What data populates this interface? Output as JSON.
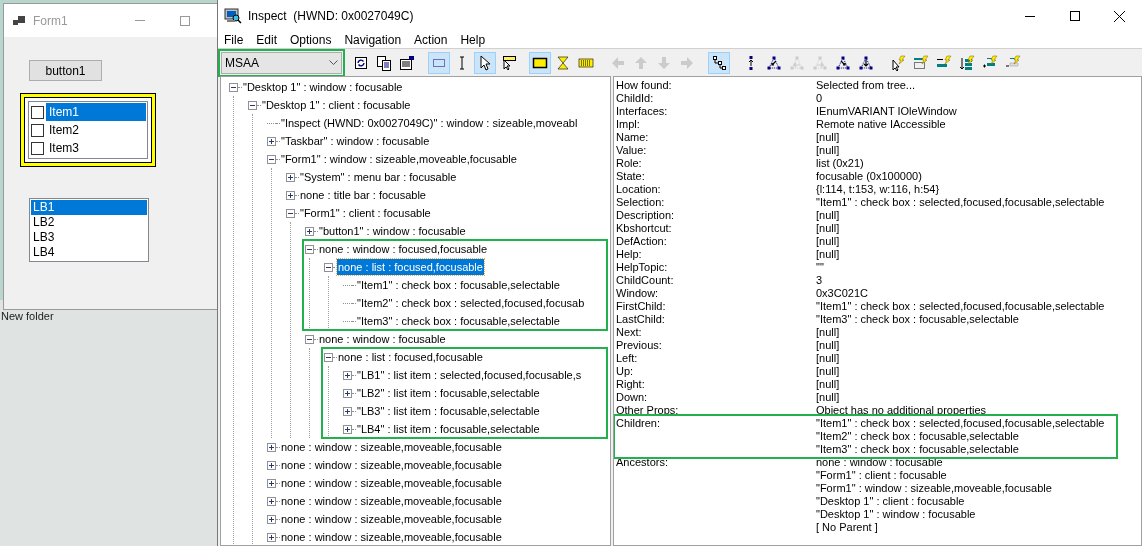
{
  "desktop": {
    "folder_label": "New folder"
  },
  "form1": {
    "title": "Form1",
    "button": "button1",
    "checklist": {
      "highlighted": true,
      "items": [
        {
          "label": "Item1",
          "checked": false,
          "selected": true
        },
        {
          "label": "Item2",
          "checked": false,
          "selected": false
        },
        {
          "label": "Item3",
          "checked": false,
          "selected": false
        }
      ]
    },
    "listbox": {
      "items": [
        {
          "label": "LB1",
          "selected": true
        },
        {
          "label": "LB2",
          "selected": false
        },
        {
          "label": "LB3",
          "selected": false
        },
        {
          "label": "LB4",
          "selected": false
        }
      ]
    }
  },
  "inspect": {
    "title": "Inspect  (HWND: 0x0027049C)",
    "menu": [
      "File",
      "Edit",
      "Options",
      "Navigation",
      "Action",
      "Help"
    ],
    "mode": {
      "value": "MSAA",
      "highlighted": true
    },
    "toolbar_groups": [
      [
        {
          "kind": "refresh",
          "pressed": false,
          "disabled": false
        },
        {
          "kind": "copy",
          "pressed": false,
          "disabled": false
        },
        {
          "kind": "properties",
          "pressed": false,
          "disabled": false
        }
      ],
      [
        {
          "kind": "rect-select",
          "pressed": true,
          "disabled": false
        },
        {
          "kind": "text-cursor",
          "pressed": false,
          "disabled": false
        },
        {
          "kind": "pointer",
          "pressed": true,
          "disabled": false
        },
        {
          "kind": "pointer-tip",
          "pressed": false,
          "disabled": false
        }
      ],
      [
        {
          "kind": "highlight-rect",
          "pressed": true,
          "disabled": false
        },
        {
          "kind": "hourglass",
          "pressed": false,
          "disabled": false
        },
        {
          "kind": "keyboard",
          "pressed": false,
          "disabled": false
        }
      ],
      [
        {
          "kind": "nav-left",
          "pressed": false,
          "disabled": true
        },
        {
          "kind": "nav-up",
          "pressed": false,
          "disabled": true
        },
        {
          "kind": "nav-down",
          "pressed": false,
          "disabled": true
        },
        {
          "kind": "nav-right",
          "pressed": false,
          "disabled": true
        }
      ],
      [
        {
          "kind": "tree-view",
          "pressed": true,
          "disabled": false
        }
      ],
      [
        {
          "kind": "nav-parent",
          "pressed": false,
          "disabled": false
        },
        {
          "kind": "tri-first",
          "pressed": false,
          "disabled": false
        },
        {
          "kind": "tri-prev",
          "pressed": false,
          "disabled": true
        },
        {
          "kind": "tri-next",
          "pressed": false,
          "disabled": true
        },
        {
          "kind": "tri-last",
          "pressed": false,
          "disabled": false
        },
        {
          "kind": "tri-children",
          "pressed": false,
          "disabled": false
        }
      ],
      [
        {
          "kind": "flash-pointer",
          "pressed": false,
          "disabled": false
        },
        {
          "kind": "flash-rect",
          "pressed": false,
          "disabled": false
        },
        {
          "kind": "flash-bar",
          "pressed": false,
          "disabled": false
        },
        {
          "kind": "flash-down",
          "pressed": false,
          "disabled": false
        },
        {
          "kind": "flash-add",
          "pressed": false,
          "disabled": false
        },
        {
          "kind": "flash-remove",
          "pressed": false,
          "disabled": false
        }
      ]
    ],
    "tree": [
      {
        "text": "\"Desktop 1\" : window : focusable",
        "kind": "expanded",
        "selected": false,
        "highlighted": false,
        "children": [
          {
            "text": "\"Desktop 1\" : client : focusable",
            "kind": "expanded",
            "selected": false,
            "highlighted": false,
            "children": [
              {
                "text": "\"Inspect  (HWND: 0x0027049C)\" : window : sizeable,moveabl",
                "kind": "leaf",
                "selected": false,
                "highlighted": false
              },
              {
                "text": "\"Taskbar\" : window : focusable",
                "kind": "collapsed",
                "selected": false,
                "highlighted": false
              },
              {
                "text": "\"Form1\" : window : sizeable,moveable,focusable",
                "kind": "expanded",
                "selected": false,
                "highlighted": false,
                "children": [
                  {
                    "text": "\"System\" : menu bar : focusable",
                    "kind": "collapsed",
                    "selected": false,
                    "highlighted": false
                  },
                  {
                    "text": "none : title bar : focusable",
                    "kind": "collapsed",
                    "selected": false,
                    "highlighted": false
                  },
                  {
                    "text": "\"Form1\" : client : focusable",
                    "kind": "expanded",
                    "selected": false,
                    "highlighted": false,
                    "children": [
                      {
                        "text": "\"button1\" : window : focusable",
                        "kind": "collapsed",
                        "selected": false,
                        "highlighted": false
                      },
                      {
                        "text": "none : window : focused,focusable",
                        "kind": "expanded",
                        "selected": false,
                        "highlighted": true,
                        "children": [
                          {
                            "text": "none : list : focused,focusable",
                            "kind": "expanded",
                            "selected": true,
                            "highlighted": false,
                            "children": [
                              {
                                "text": "\"Item1\" : check box : focusable,selectable",
                                "kind": "leaf",
                                "selected": false,
                                "highlighted": false
                              },
                              {
                                "text": "\"Item2\" : check box : selected,focused,focusab",
                                "kind": "leaf",
                                "selected": false,
                                "highlighted": false
                              },
                              {
                                "text": "\"Item3\" : check box : focusable,selectable",
                                "kind": "leaf",
                                "selected": false,
                                "highlighted": false
                              }
                            ]
                          }
                        ]
                      },
                      {
                        "text": "none : window : focusable",
                        "kind": "expanded",
                        "selected": false,
                        "highlighted": false,
                        "children": [
                          {
                            "text": "none : list : focused,focusable",
                            "kind": "expanded",
                            "selected": false,
                            "highlighted": true,
                            "children": [
                              {
                                "text": "\"LB1\" : list item : selected,focused,focusable,s",
                                "kind": "collapsed",
                                "selected": false,
                                "highlighted": false
                              },
                              {
                                "text": "\"LB2\" : list item : focusable,selectable",
                                "kind": "collapsed",
                                "selected": false,
                                "highlighted": false
                              },
                              {
                                "text": "\"LB3\" : list item : focusable,selectable",
                                "kind": "collapsed",
                                "selected": false,
                                "highlighted": false
                              },
                              {
                                "text": "\"LB4\" : list item : focusable,selectable",
                                "kind": "collapsed",
                                "selected": false,
                                "highlighted": false
                              }
                            ]
                          }
                        ]
                      }
                    ]
                  }
                ]
              },
              {
                "text": "none : window : sizeable,moveable,focusable",
                "kind": "collapsed",
                "selected": false,
                "highlighted": false
              },
              {
                "text": "none : window : sizeable,moveable,focusable",
                "kind": "collapsed",
                "selected": false,
                "highlighted": false
              },
              {
                "text": "none : window : sizeable,moveable,focusable",
                "kind": "collapsed",
                "selected": false,
                "highlighted": false
              },
              {
                "text": "none : window : sizeable,moveable,focusable",
                "kind": "collapsed",
                "selected": false,
                "highlighted": false
              },
              {
                "text": "none : window : sizeable,moveable,focusable",
                "kind": "collapsed",
                "selected": false,
                "highlighted": false
              },
              {
                "text": "none : window : sizeable,moveable,focusable",
                "kind": "collapsed",
                "selected": false,
                "highlighted": false
              }
            ]
          }
        ]
      }
    ],
    "properties": [
      {
        "label": "How found:",
        "values": [
          "Selected from tree..."
        ],
        "highlighted": false
      },
      {
        "label": "ChildId:",
        "values": [
          "0"
        ],
        "highlighted": false
      },
      {
        "label": "Interfaces:",
        "values": [
          "IEnumVARIANT IOleWindow"
        ],
        "highlighted": false
      },
      {
        "label": "Impl:",
        "values": [
          "Remote native IAccessible"
        ],
        "highlighted": false
      },
      {
        "label": "Name:",
        "values": [
          "[null]"
        ],
        "highlighted": false
      },
      {
        "label": "Value:",
        "values": [
          "[null]"
        ],
        "highlighted": false
      },
      {
        "label": "Role:",
        "values": [
          "list (0x21)"
        ],
        "highlighted": false
      },
      {
        "label": "State:",
        "values": [
          "focusable (0x100000)"
        ],
        "highlighted": false
      },
      {
        "label": "Location:",
        "values": [
          "{l:114, t:153, w:116, h:54}"
        ],
        "highlighted": false
      },
      {
        "label": "Selection:",
        "values": [
          "\"Item1\" : check box : selected,focused,focusable,selectable"
        ],
        "highlighted": false
      },
      {
        "label": "Description:",
        "values": [
          "[null]"
        ],
        "highlighted": false
      },
      {
        "label": "Kbshortcut:",
        "values": [
          "[null]"
        ],
        "highlighted": false
      },
      {
        "label": "DefAction:",
        "values": [
          "[null]"
        ],
        "highlighted": false
      },
      {
        "label": "Help:",
        "values": [
          "[null]"
        ],
        "highlighted": false
      },
      {
        "label": "HelpTopic:",
        "values": [
          "\"\""
        ],
        "highlighted": false
      },
      {
        "label": "ChildCount:",
        "values": [
          "3"
        ],
        "highlighted": false
      },
      {
        "label": "Window:",
        "values": [
          "0x3C021C"
        ],
        "highlighted": false
      },
      {
        "label": "FirstChild:",
        "values": [
          "\"Item1\" : check box : selected,focused,focusable,selectable"
        ],
        "highlighted": false
      },
      {
        "label": "LastChild:",
        "values": [
          "\"Item3\" : check box : focusable,selectable"
        ],
        "highlighted": false
      },
      {
        "label": "Next:",
        "values": [
          "[null]"
        ],
        "highlighted": false
      },
      {
        "label": "Previous:",
        "values": [
          "[null]"
        ],
        "highlighted": false
      },
      {
        "label": "Left:",
        "values": [
          "[null]"
        ],
        "highlighted": false
      },
      {
        "label": "Up:",
        "values": [
          "[null]"
        ],
        "highlighted": false
      },
      {
        "label": "Right:",
        "values": [
          "[null]"
        ],
        "highlighted": false
      },
      {
        "label": "Down:",
        "values": [
          "[null]"
        ],
        "highlighted": false
      },
      {
        "label": "Other Props:",
        "values": [
          "Object has no additional properties"
        ],
        "highlighted": false
      },
      {
        "label": "Children:",
        "values": [
          "\"Item1\" : check box : selected,focused,focusable,selectable",
          "\"Item2\" : check box : focusable,selectable",
          "\"Item3\" : check box : focusable,selectable"
        ],
        "highlighted": true
      },
      {
        "label": "Ancestors:",
        "values": [
          "none : window : focusable",
          "\"Form1\" : client : focusable",
          "\"Form1\" : window : sizeable,moveable,focusable",
          "\"Desktop 1\" : client : focusable",
          "\"Desktop 1\" : window : focusable",
          "[ No Parent ]"
        ],
        "highlighted": false
      }
    ]
  }
}
